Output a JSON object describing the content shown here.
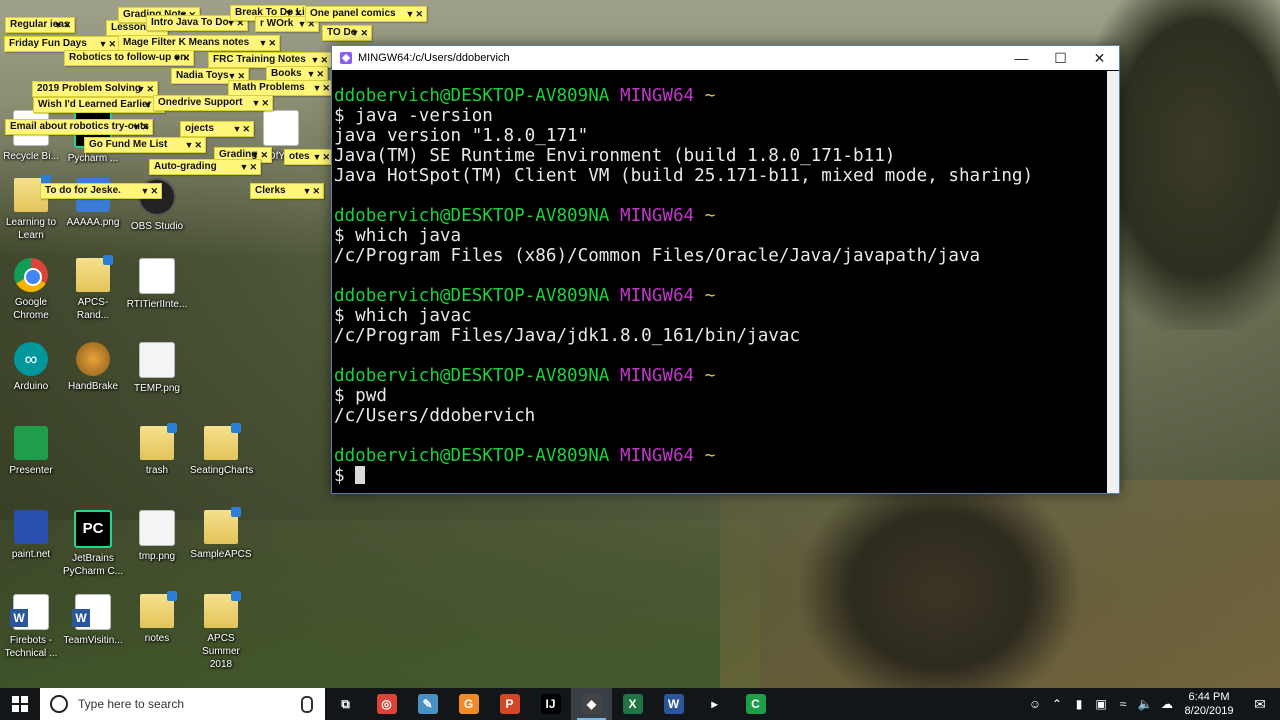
{
  "sticky_notes": [
    {
      "label": "Regular ieas",
      "x": 0
    },
    {
      "label": "Lesson",
      "x": 0
    },
    {
      "label": "Grading Note",
      "x": 0
    },
    {
      "label": "Intro Java To Do",
      "x": 0
    },
    {
      "label": "Break To Do Lis",
      "x": 0
    },
    {
      "label": "r WOrk",
      "x": 0
    },
    {
      "label": "One panel comics",
      "x": 0
    },
    {
      "label": "Friday Fun Days",
      "x": 0
    },
    {
      "label": "Mage Filter K Means notes",
      "x": 0
    },
    {
      "label": "Robotics to follow-up on:",
      "x": 0
    },
    {
      "label": "FRC Training Notes",
      "x": 0
    },
    {
      "label": "TO Do",
      "x": 0
    },
    {
      "label": "Nadia Toys",
      "x": 0
    },
    {
      "label": "Books",
      "x": 0
    },
    {
      "label": "2019 Problem Solving",
      "x": 0
    },
    {
      "label": "Math Problems",
      "x": 0
    },
    {
      "label": "Wish I'd Learned Earlier",
      "x": 0
    },
    {
      "label": "Onedrive Support",
      "x": 0
    },
    {
      "label": "Email about robotics try-outs",
      "x": 0
    },
    {
      "label": "ojects",
      "x": 0
    },
    {
      "label": "Go Fund Me List",
      "x": 0
    },
    {
      "label": "Grading",
      "x": 0
    },
    {
      "label": "otes",
      "x": 0
    },
    {
      "label": "Auto-grading",
      "x": 0
    },
    {
      "label": "To do for Jeske.",
      "x": 0
    },
    {
      "label": "Clerks",
      "x": 0
    }
  ],
  "desktop_icons": [
    {
      "label": "Recycle Bi...",
      "type": "doc"
    },
    {
      "label": "Pycharm ...",
      "type": "pycharm"
    },
    {
      "label": "EndOfYearPr...",
      "type": "doc"
    },
    {
      "label": "Learning to Learn",
      "type": "folder"
    },
    {
      "label": "AAAAA.png",
      "type": "aaaaa"
    },
    {
      "label": "OBS Studio",
      "type": "obs"
    },
    {
      "label": "Google Chrome",
      "type": "chrome"
    },
    {
      "label": "APCS-Rand...",
      "type": "folder"
    },
    {
      "label": "RTITierIInte...",
      "type": "doc"
    },
    {
      "label": "Arduino",
      "type": "arduino"
    },
    {
      "label": "HandBrake",
      "type": "handbrake"
    },
    {
      "label": "TEMP.png",
      "type": "png"
    },
    {
      "label": "Presenter",
      "type": "presenter"
    },
    {
      "label": "trash",
      "type": "folder"
    },
    {
      "label": "SeatingCharts",
      "type": "folder"
    },
    {
      "label": "paint.net",
      "type": "paint"
    },
    {
      "label": "JetBrains PyCharm C...",
      "type": "pycharm"
    },
    {
      "label": "tmp.png",
      "type": "png"
    },
    {
      "label": "SampleAPCS",
      "type": "folder"
    },
    {
      "label": "Firebots - Technical ...",
      "type": "word"
    },
    {
      "label": "TeamVisitin...",
      "type": "word"
    },
    {
      "label": "notes",
      "type": "folder"
    },
    {
      "label": "APCS Summer 2018",
      "type": "folder"
    }
  ],
  "terminal": {
    "title": "MINGW64:/c/Users/ddobervich",
    "prompt_user": "ddobervich@DESKTOP-AV809NA",
    "prompt_env": "MINGW64",
    "prompt_path": "~",
    "lines": [
      {
        "kind": "prompt"
      },
      {
        "kind": "cmd",
        "text": "$ java -version"
      },
      {
        "kind": "out",
        "text": "java version \"1.8.0_171\""
      },
      {
        "kind": "out",
        "text": "Java(TM) SE Runtime Environment (build 1.8.0_171-b11)"
      },
      {
        "kind": "out",
        "text": "Java HotSpot(TM) Client VM (build 25.171-b11, mixed mode, sharing)"
      },
      {
        "kind": "blank"
      },
      {
        "kind": "prompt"
      },
      {
        "kind": "cmd",
        "text": "$ which java"
      },
      {
        "kind": "out",
        "text": "/c/Program Files (x86)/Common Files/Oracle/Java/javapath/java"
      },
      {
        "kind": "blank"
      },
      {
        "kind": "prompt"
      },
      {
        "kind": "cmd",
        "text": "$ which javac"
      },
      {
        "kind": "out",
        "text": "/c/Program Files/Java/jdk1.8.0_161/bin/javac"
      },
      {
        "kind": "blank"
      },
      {
        "kind": "prompt"
      },
      {
        "kind": "cmd",
        "text": "$ pwd"
      },
      {
        "kind": "out",
        "text": "/c/Users/ddobervich"
      },
      {
        "kind": "blank"
      },
      {
        "kind": "prompt"
      },
      {
        "kind": "input",
        "text": "$"
      }
    ],
    "colors": {
      "user": "#19d23a",
      "env": "#c436c8",
      "path": "#d6c84a",
      "text": "#e8e8e8",
      "bg": "#000000"
    }
  },
  "taskbar": {
    "search_placeholder": "Type here to search",
    "apps": [
      {
        "name": "task-view",
        "icon": "task-view-icon",
        "color": "#121619",
        "glyph": "⧉"
      },
      {
        "name": "chrome",
        "icon": "chrome-icon",
        "color": "#db4437",
        "glyph": "◎"
      },
      {
        "name": "notepad",
        "icon": "notepad-icon",
        "color": "#4a90c2",
        "glyph": "✎"
      },
      {
        "name": "app-g",
        "icon": "g-app-icon",
        "color": "#f08a24",
        "glyph": "G"
      },
      {
        "name": "powerpoint",
        "icon": "powerpoint-icon",
        "color": "#d24726",
        "glyph": "P"
      },
      {
        "name": "intellij",
        "icon": "intellij-icon",
        "color": "#000000",
        "glyph": "IJ"
      },
      {
        "name": "git-bash",
        "icon": "git-bash-icon",
        "color": "#444444",
        "glyph": "◆"
      },
      {
        "name": "excel",
        "icon": "excel-icon",
        "color": "#217346",
        "glyph": "X"
      },
      {
        "name": "word",
        "icon": "word-icon",
        "color": "#2b579a",
        "glyph": "W"
      },
      {
        "name": "terminal-arrow",
        "icon": "arrow-icon",
        "color": "#121619",
        "glyph": "▸"
      },
      {
        "name": "app-c",
        "icon": "c-app-icon",
        "color": "#1e9e4a",
        "glyph": "C"
      }
    ],
    "tray_icons": [
      "person-icon",
      "chevron-up-icon",
      "battery-icon",
      "network-icon",
      "wifi-icon",
      "volume-icon",
      "onedrive-icon"
    ],
    "time": "6:44 PM",
    "date": "8/20/2019"
  }
}
